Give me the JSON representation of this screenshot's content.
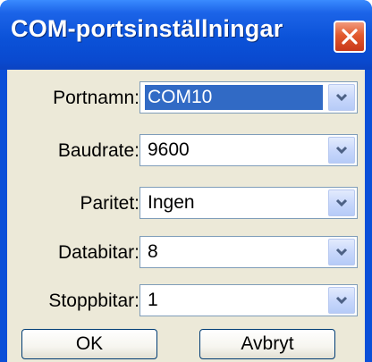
{
  "dialog": {
    "title": "COM-portsinställningar"
  },
  "fields": [
    {
      "label": "Portnamn:",
      "value": "COM10"
    },
    {
      "label": "Baudrate:",
      "value": "9600"
    },
    {
      "label": "Paritet:",
      "value": "Ingen"
    },
    {
      "label": "Databitar:",
      "value": "8"
    },
    {
      "label": "Stoppbitar:",
      "value": "1"
    }
  ],
  "buttons": {
    "ok_label": "OK",
    "cancel_label": "Avbryt"
  },
  "icons": {
    "close": "close-icon",
    "dropdown": "chevron-down-icon"
  },
  "colors": {
    "titlebar": "#0a4fd8",
    "close": "#e25a2e",
    "selection": "#316ac5",
    "dialog_body": "#ece9d8"
  }
}
